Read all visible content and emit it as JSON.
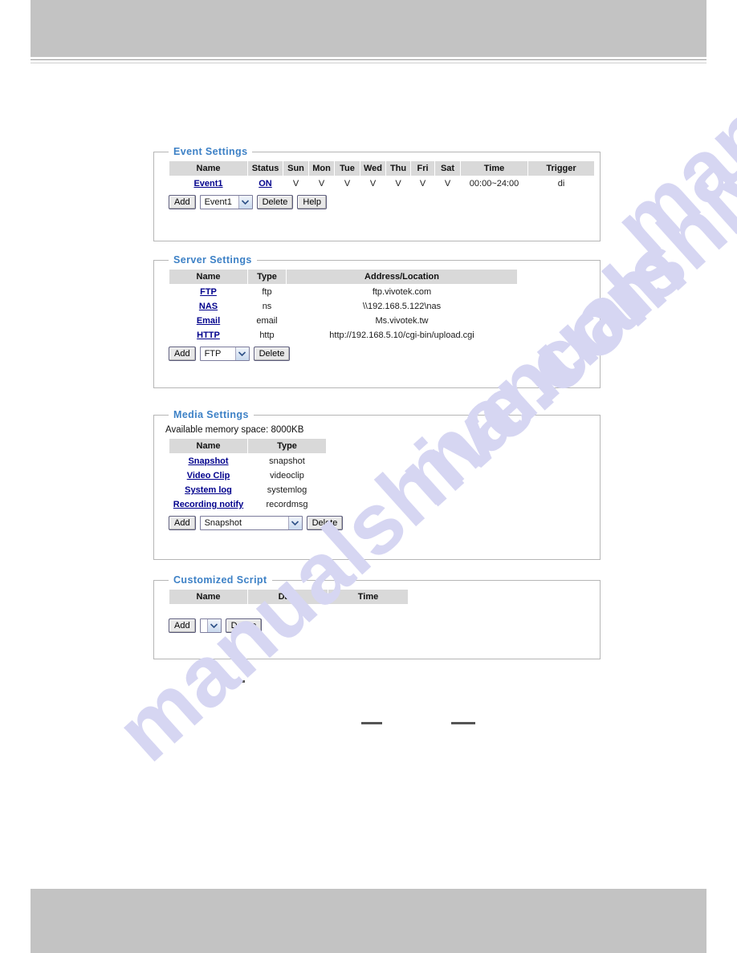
{
  "page": {
    "watermark_text": "manualshive.com"
  },
  "event_settings": {
    "legend": "Event Settings",
    "columns": [
      "Name",
      "Status",
      "Sun",
      "Mon",
      "Tue",
      "Wed",
      "Thu",
      "Fri",
      "Sat",
      "Time",
      "Trigger"
    ],
    "rows": [
      {
        "name": "Event1",
        "status": "ON",
        "sun": "V",
        "mon": "V",
        "tue": "V",
        "wed": "V",
        "thu": "V",
        "fri": "V",
        "sat": "V",
        "time": "00:00~24:00",
        "trigger": "di"
      }
    ],
    "controls": {
      "add_label": "Add",
      "select_value": "Event1",
      "delete_label": "Delete",
      "help_label": "Help"
    }
  },
  "server_settings": {
    "legend": "Server Settings",
    "columns": [
      "Name",
      "Type",
      "Address/Location"
    ],
    "rows": [
      {
        "name": "FTP",
        "type": "ftp",
        "address": "ftp.vivotek.com"
      },
      {
        "name": "NAS",
        "type": "ns",
        "address": "\\\\192.168.5.122\\nas"
      },
      {
        "name": "Email",
        "type": "email",
        "address": "Ms.vivotek.tw"
      },
      {
        "name": "HTTP",
        "type": "http",
        "address": "http://192.168.5.10/cgi-bin/upload.cgi"
      }
    ],
    "controls": {
      "add_label": "Add",
      "select_value": "FTP",
      "delete_label": "Delete"
    }
  },
  "media_settings": {
    "legend": "Media Settings",
    "memory_note": "Available memory space: 8000KB",
    "columns": [
      "Name",
      "Type"
    ],
    "rows": [
      {
        "name": "Snapshot",
        "type": "snapshot"
      },
      {
        "name": "Video Clip",
        "type": "videoclip"
      },
      {
        "name": "System log",
        "type": "systemlog"
      },
      {
        "name": "Recording notify",
        "type": "recordmsg"
      }
    ],
    "controls": {
      "add_label": "Add",
      "select_value": "Snapshot",
      "delete_label": "Delete"
    }
  },
  "customized_script": {
    "legend": "Customized Script",
    "columns": [
      "Name",
      "Date",
      "Time"
    ],
    "rows": [],
    "controls": {
      "add_label": "Add",
      "select_value": "",
      "delete_label": "Delete"
    }
  }
}
